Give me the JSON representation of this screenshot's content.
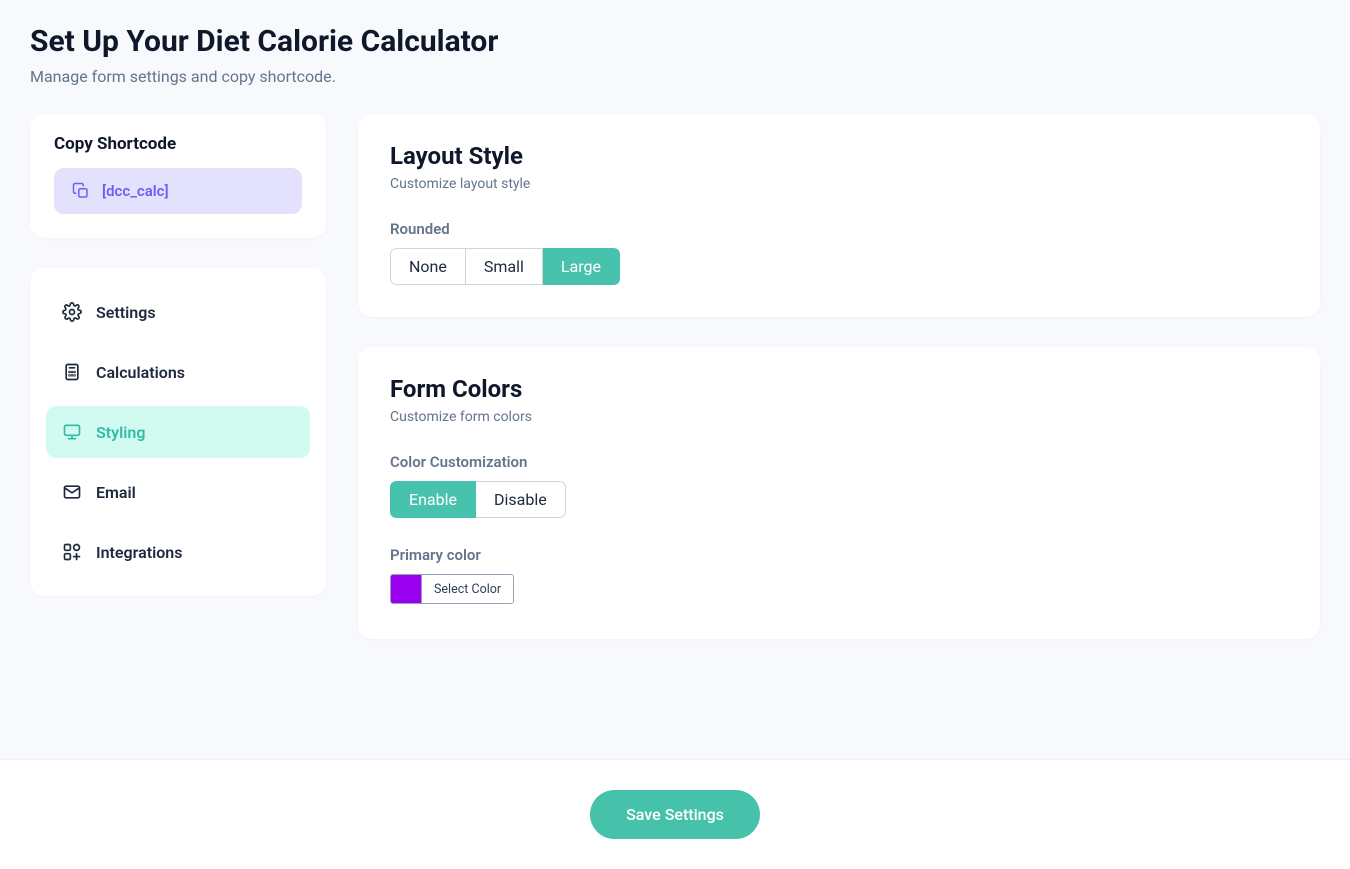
{
  "header": {
    "title": "Set Up Your Diet Calorie Calculator",
    "subtitle": "Manage form settings and copy shortcode."
  },
  "shortcode": {
    "title": "Copy Shortcode",
    "value": "[dcc_calc]"
  },
  "nav": {
    "items": [
      {
        "label": "Settings",
        "active": false
      },
      {
        "label": "Calculations",
        "active": false
      },
      {
        "label": "Styling",
        "active": true
      },
      {
        "label": "Email",
        "active": false
      },
      {
        "label": "Integrations",
        "active": false
      }
    ]
  },
  "layoutStyle": {
    "title": "Layout Style",
    "subtitle": "Customize layout style",
    "roundedLabel": "Rounded",
    "options": {
      "none": "None",
      "small": "Small",
      "large": "Large"
    },
    "selected": "large"
  },
  "formColors": {
    "title": "Form Colors",
    "subtitle": "Customize form colors",
    "customizationLabel": "Color Customization",
    "options": {
      "enable": "Enable",
      "disable": "Disable"
    },
    "selected": "enable",
    "primaryLabel": "Primary color",
    "primaryColor": "#9900ef",
    "selectColorLabel": "Select Color"
  },
  "footer": {
    "save": "Save Settings"
  }
}
